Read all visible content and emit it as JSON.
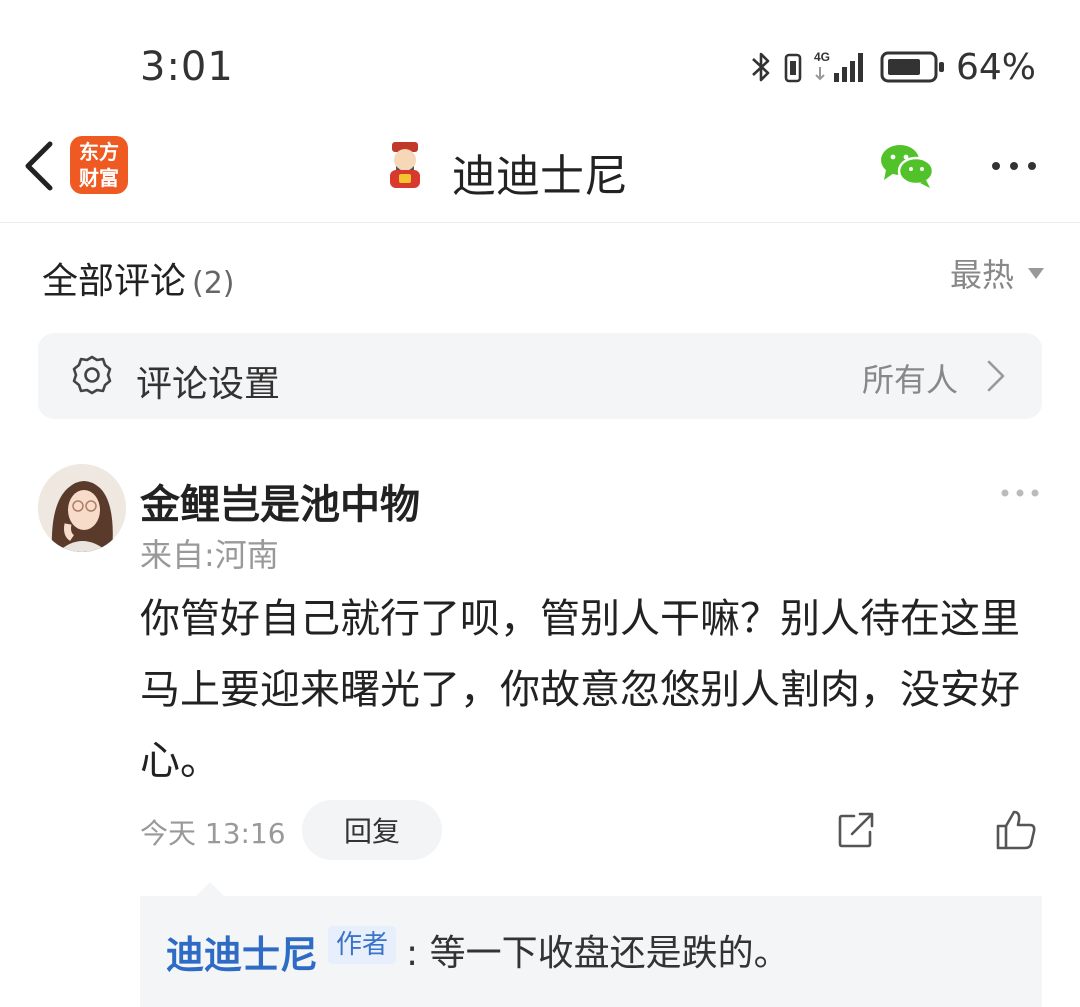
{
  "status_bar": {
    "time": "3:01",
    "battery_percent": "64%",
    "network": "4G"
  },
  "header": {
    "back_icon": "chevron-left-icon",
    "app_logo_line1": "东方",
    "app_logo_line2": "财富",
    "title": "迪迪士尼",
    "share_icon": "wechat-icon",
    "more_icon": "more-icon"
  },
  "comments": {
    "section_title": "全部评论",
    "count": "(2)",
    "sort_label": "最热",
    "settings_label": "评论设置",
    "settings_value": "所有人"
  },
  "comment": {
    "author": "金鲤岂是池中物",
    "location": "来自:河南",
    "text": "你管好自己就行了呗，管别人干嘛？别人待在这里马上要迎来曙光了，你故意忽悠别人割肉，没安好心。",
    "time": "今天 13:16",
    "reply_label": "回复"
  },
  "reply": {
    "author": "迪迪士尼",
    "badge": "作者",
    "text": ": 等一下收盘还是跌的。"
  },
  "colors": {
    "accent_blue": "#2d6bc4",
    "logo_orange": "#ef5a22",
    "wechat_green": "#52c22a"
  }
}
